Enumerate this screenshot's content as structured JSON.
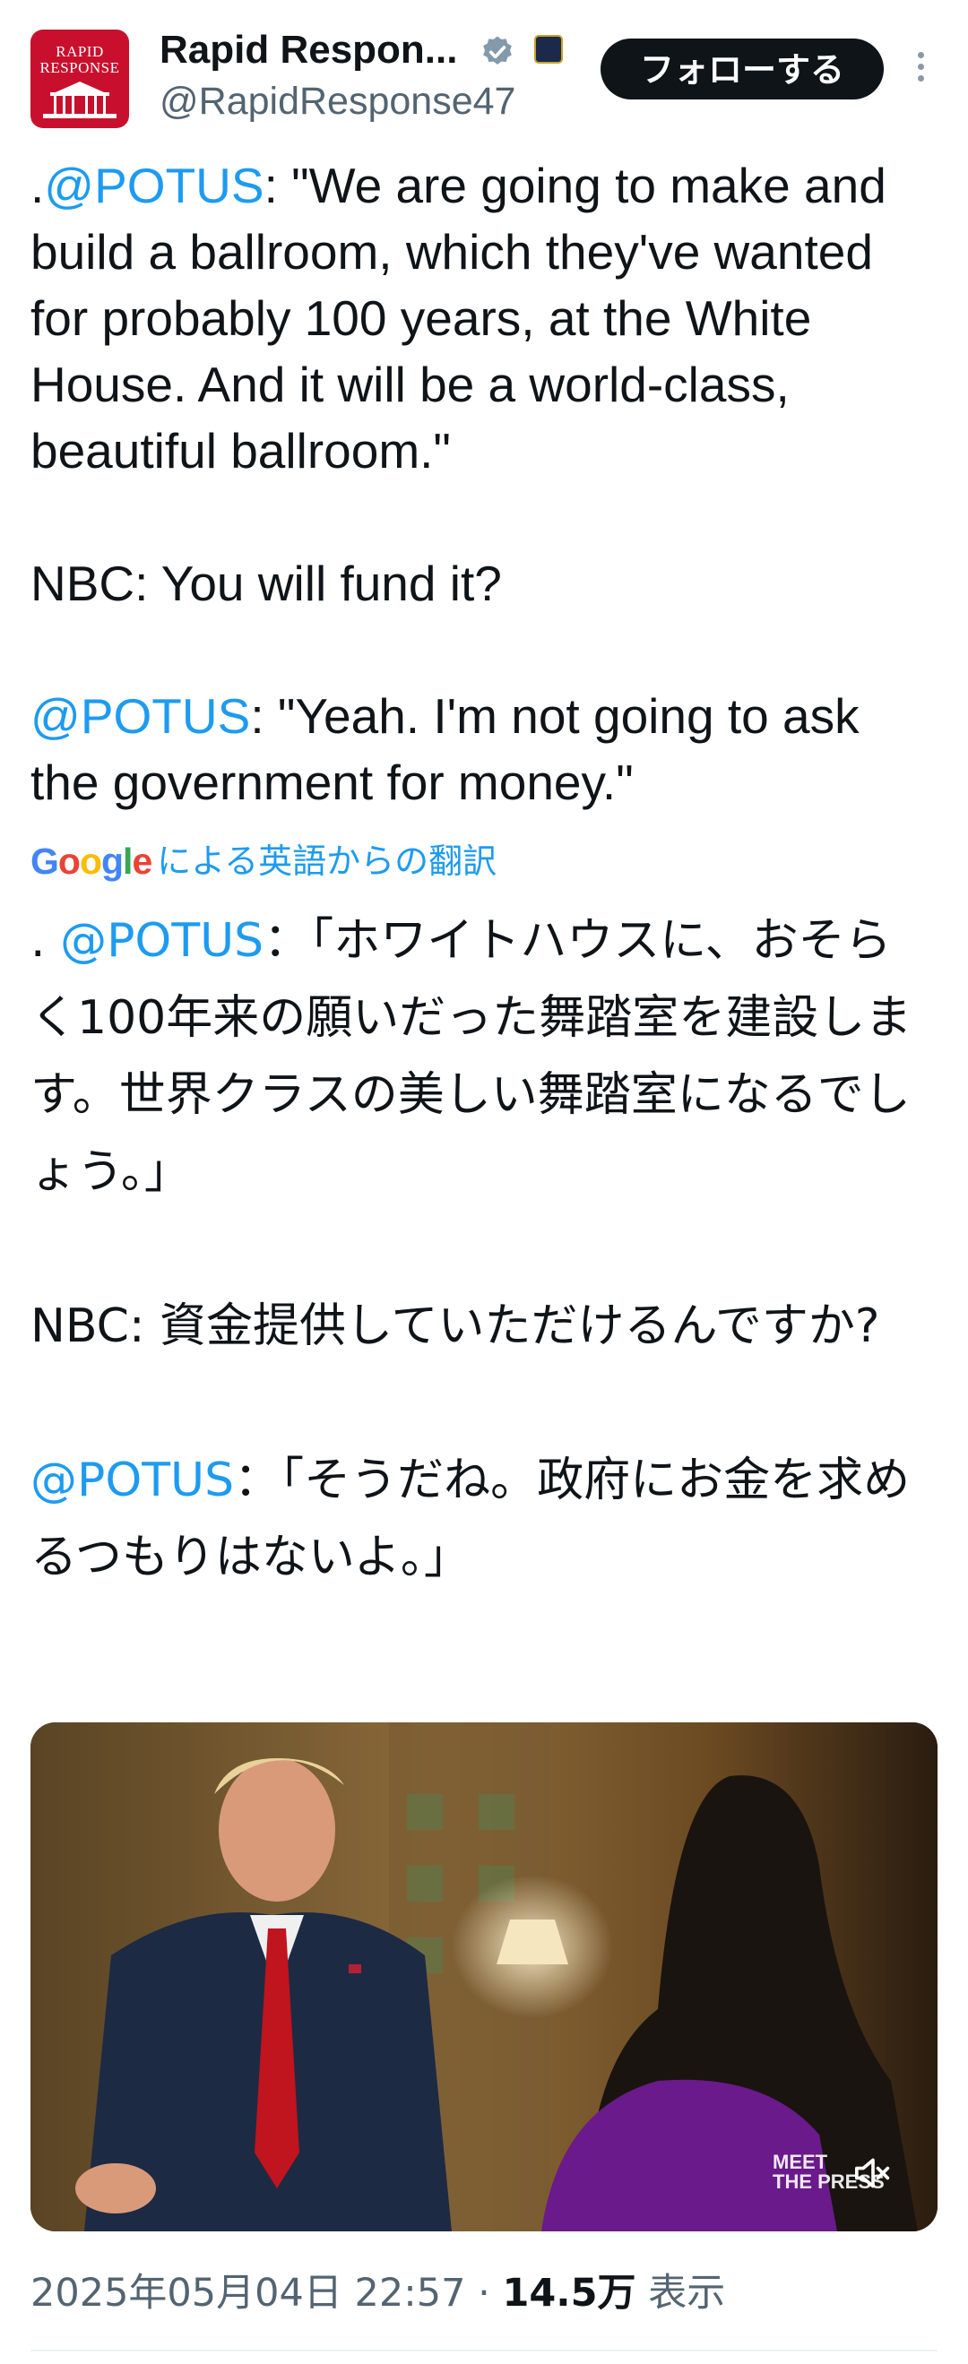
{
  "account": {
    "name": "Rapid Respon...",
    "handle": "@RapidResponse47",
    "avatar_line1": "RAPID",
    "avatar_line2": "RESPONSE",
    "verified_color": "#829aab"
  },
  "follow_label": "フォローする",
  "tweet": {
    "p1_prefix": ".",
    "p1_mention": "@POTUS",
    "p1_text": ": \"We are going to make and build a ballroom, which they've wanted for probably 100 years, at the White House. And it will be a world-class, beautiful ballroom.\"",
    "p2_text": "NBC: You will fund it?",
    "p3_mention": "@POTUS",
    "p3_text": ": \"Yeah. I'm not going to ask the government for money.\""
  },
  "translation": {
    "logo": "Google",
    "label": "による英語からの翻訳",
    "p1_prefix": ". ",
    "p1_mention": "@POTUS",
    "p1_text": "：「ホワイトハウスに、おそらく100年来の願いだった舞踏室を建設します。世界クラスの美しい舞踏室になるでしょう。」",
    "p2_text": "NBC: 資金提供していただけるんですか?",
    "p3_mention": "@POTUS",
    "p3_text": "：「そうだね。政府にお金を求めるつもりはないよ。」"
  },
  "media": {
    "watermark_line1": "MEET",
    "watermark_line2": "THE PRESS"
  },
  "meta": {
    "timestamp": "2025年05月04日 22:57",
    "separator": " · ",
    "views_count": "14.5万",
    "views_label": " 表示"
  },
  "colors": {
    "link": "#1d9bf0",
    "text": "#0f1419",
    "secondary": "#536471",
    "button_bg": "#0f1419"
  }
}
